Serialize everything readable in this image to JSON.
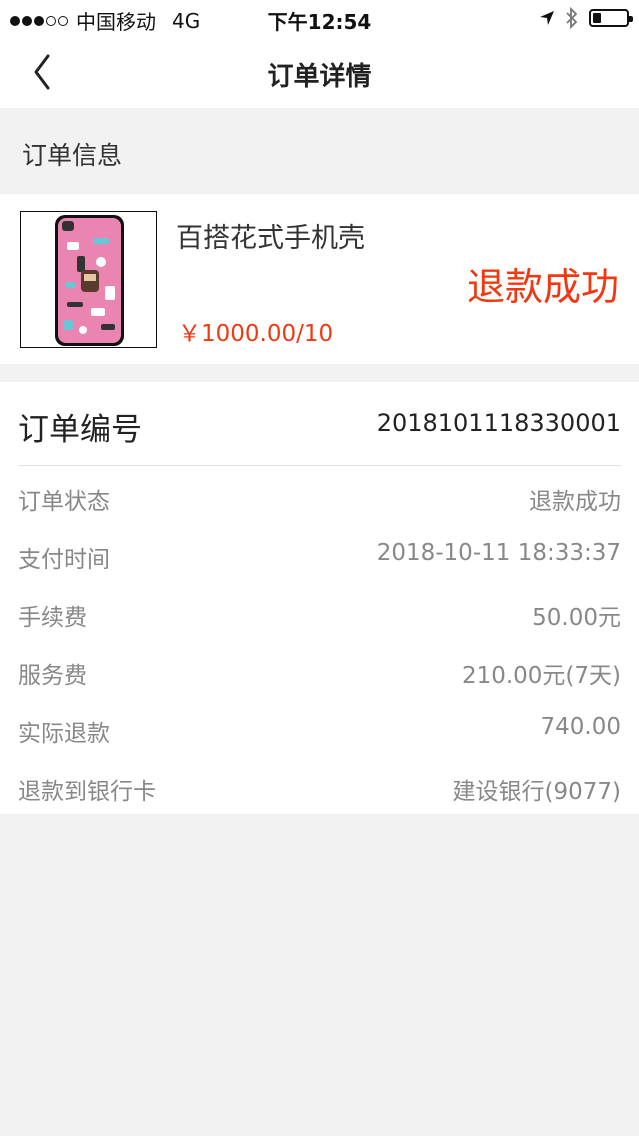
{
  "status_bar": {
    "carrier": "中国移动",
    "network": "4G",
    "time": "下午12:54",
    "battery_level": 0.25
  },
  "nav": {
    "title": "订单详情",
    "back_icon": "chevron-left-icon"
  },
  "section": {
    "title": "订单信息"
  },
  "product": {
    "name": "百搭花式手机壳",
    "price": "￥1000.00/10",
    "status": "退款成功",
    "image": "phone-case-image"
  },
  "order": {
    "number_label": "订单编号",
    "number_value": "201810111833000 1",
    "rows": [
      {
        "label": "订单状态",
        "value": "退款成功"
      },
      {
        "label": "支付时间",
        "value": "2018-10-11 18:33:37"
      },
      {
        "label": "手续费",
        "value": "50.00元"
      },
      {
        "label": "服务费",
        "value": "210.00元(7天)"
      },
      {
        "label": "实际退款",
        "value": "740.00"
      },
      {
        "label": "退款到银行卡",
        "value": "建设银行(9077)"
      }
    ]
  },
  "colors": {
    "accent_red": "#f03812",
    "background": "#f2f2f2",
    "muted_text": "#888888"
  }
}
